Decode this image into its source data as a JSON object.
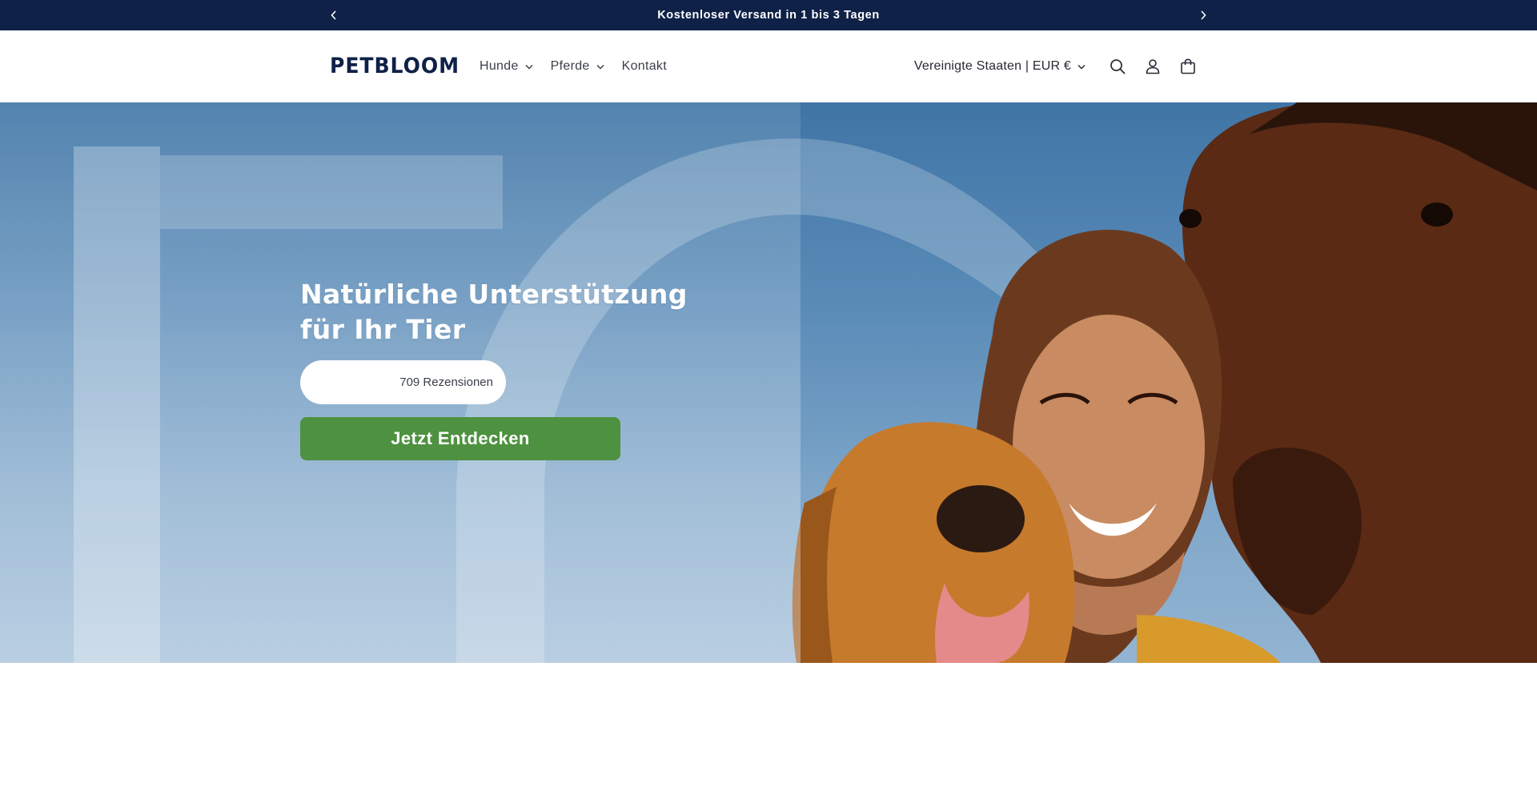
{
  "announcement": {
    "text": "Kostenloser Versand in 1 bis 3 Tagen",
    "prev_icon": "chevron-left-icon",
    "next_icon": "chevron-right-icon"
  },
  "header": {
    "logo": "PETBLOOM",
    "nav": [
      {
        "label": "Hunde",
        "has_dropdown": true
      },
      {
        "label": "Pferde",
        "has_dropdown": true
      },
      {
        "label": "Kontakt",
        "has_dropdown": false
      }
    ],
    "locale": "Vereinigte Staaten | EUR €",
    "icons": [
      "search-icon",
      "account-icon",
      "cart-icon"
    ]
  },
  "hero": {
    "title_line1": "Natürliche Unterstützung",
    "title_line2": "für Ihr Tier",
    "reviews": "709 Rezensionen",
    "cta": "Jetzt Entdecken"
  },
  "colors": {
    "announcement_bg": "#0f2147",
    "logo": "#0f2147",
    "cta_bg": "#4e9140",
    "hero_sky": "#5b8cb8"
  }
}
